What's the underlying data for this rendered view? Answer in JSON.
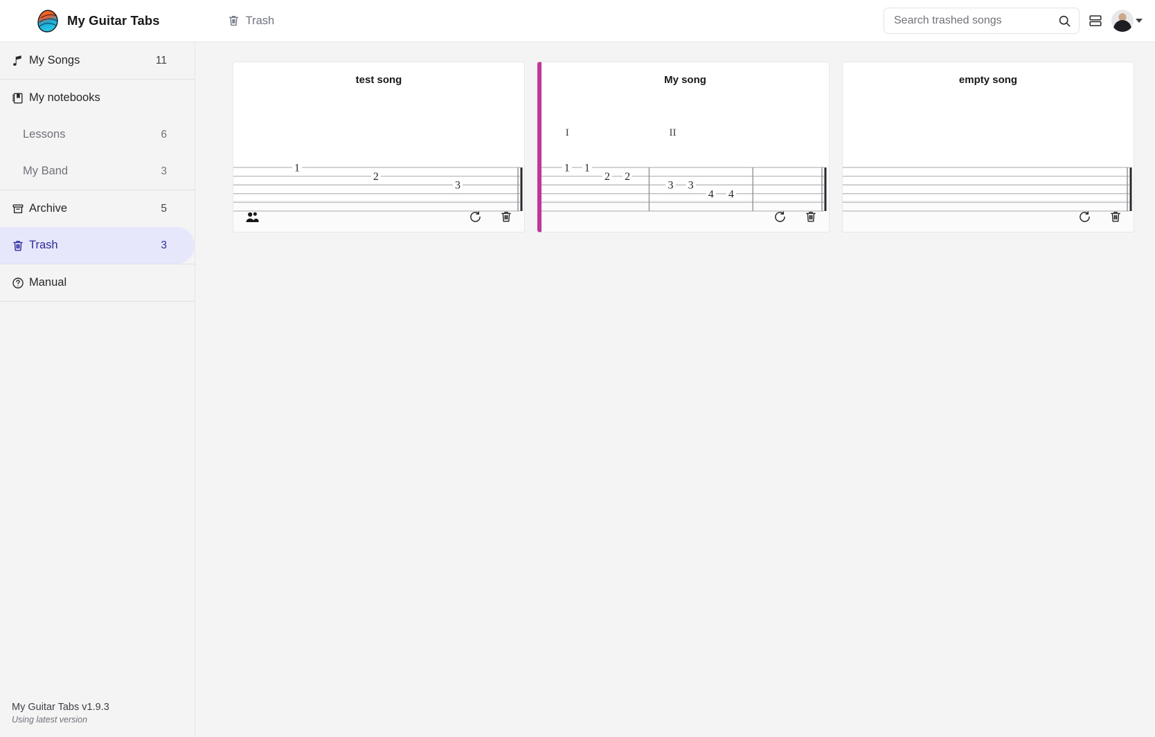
{
  "app": {
    "brand_name": "My Guitar Tabs",
    "logo_icon": "guitar-pick-logo",
    "version_line": "My Guitar Tabs v1.9.3",
    "version_status": "Using latest version"
  },
  "header": {
    "breadcrumb_label": "Trash",
    "breadcrumb_icon": "trash-icon",
    "search": {
      "placeholder": "Search trashed songs",
      "value": "",
      "icon": "search-icon"
    },
    "layout_toggle_icon": "layout-rows-icon",
    "avatar_icon": "user-avatar",
    "avatar_caret_icon": "chevron-down-icon"
  },
  "sidebar": {
    "groups": [
      {
        "items": [
          {
            "label": "My Songs",
            "count": "11",
            "icon": "music-note-icon",
            "active": false,
            "sub": false
          }
        ]
      },
      {
        "items": [
          {
            "label": "My notebooks",
            "count": "",
            "icon": "notebook-icon",
            "active": false,
            "sub": false
          },
          {
            "label": "Lessons",
            "count": "6",
            "icon": "",
            "active": false,
            "sub": true
          },
          {
            "label": "My Band",
            "count": "3",
            "icon": "",
            "active": false,
            "sub": true
          }
        ]
      },
      {
        "items": [
          {
            "label": "Archive",
            "count": "5",
            "icon": "archive-icon",
            "active": false,
            "sub": false
          },
          {
            "label": "Trash",
            "count": "3",
            "icon": "trash-icon",
            "active": true,
            "sub": false
          }
        ]
      },
      {
        "items": [
          {
            "label": "Manual",
            "count": "",
            "icon": "help-circle-icon",
            "active": false,
            "sub": false
          }
        ]
      }
    ]
  },
  "main": {
    "cards": [
      {
        "title": "test song",
        "accent": false,
        "accent_color": "",
        "bars": [],
        "notes": [
          {
            "fret": "1",
            "string": 1,
            "x": 18
          },
          {
            "fret": "2",
            "string": 2,
            "x": 45
          },
          {
            "fret": "3",
            "string": 3,
            "x": 73
          }
        ],
        "barlines": [],
        "end_double_bar": true,
        "actions": {
          "shared_icon": "people-shared-icon",
          "restore_icon": "restore-icon",
          "delete_icon": "trash-icon"
        },
        "has_shared": true
      },
      {
        "title": "My song",
        "accent": true,
        "accent_color": "#c0369c",
        "bars": [
          {
            "label": "I",
            "x": 5
          },
          {
            "label": "II",
            "x": 41
          }
        ],
        "notes": [
          {
            "fret": "1",
            "string": 1,
            "x": 5
          },
          {
            "fret": "1",
            "string": 1,
            "x": 12
          },
          {
            "fret": "2",
            "string": 2,
            "x": 19
          },
          {
            "fret": "2",
            "string": 2,
            "x": 26
          },
          {
            "fret": "3",
            "string": 3,
            "x": 41
          },
          {
            "fret": "3",
            "string": 3,
            "x": 48
          },
          {
            "fret": "4",
            "string": 4,
            "x": 55
          },
          {
            "fret": "4",
            "string": 4,
            "x": 62
          }
        ],
        "barlines": [
          34,
          70
        ],
        "end_double_bar": true,
        "actions": {
          "shared_icon": "",
          "restore_icon": "restore-icon",
          "delete_icon": "trash-icon"
        },
        "has_shared": false
      },
      {
        "title": "empty song",
        "accent": false,
        "accent_color": "",
        "bars": [],
        "notes": [],
        "barlines": [],
        "end_double_bar": true,
        "actions": {
          "shared_icon": "",
          "restore_icon": "restore-icon",
          "delete_icon": "trash-icon"
        },
        "has_shared": false
      }
    ]
  },
  "colors": {
    "accent_pink": "#c0369c",
    "active_bg": "#e7e7fb",
    "active_fg": "#2b2ba8",
    "page_bg": "#f4f4f5"
  }
}
